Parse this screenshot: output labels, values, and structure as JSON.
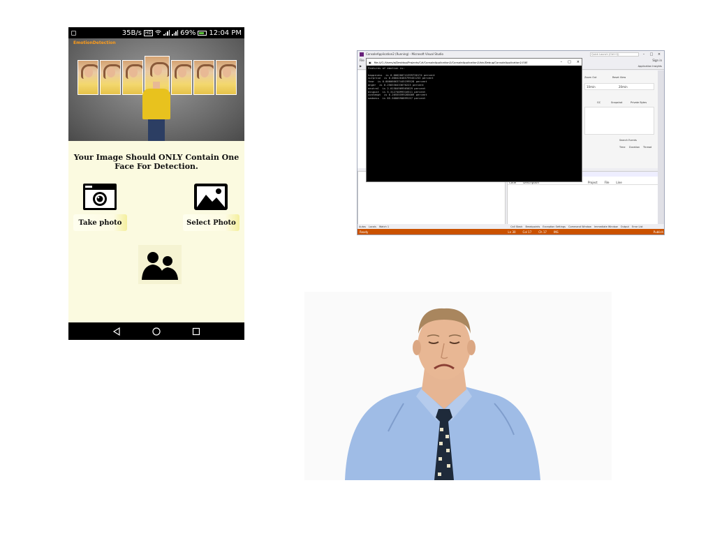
{
  "phone": {
    "status": {
      "speed": "35B/s",
      "battery": "69%",
      "time": "12:04 PM",
      "network": "4G"
    },
    "brand": "EmotionDetection",
    "instruction": "Your Image Should ONLY Contain One Face For Detection.",
    "take_photo_label": "Take photo",
    "select_photo_label": "Select Photo",
    "icons": {
      "camera": "camera-icon",
      "gallery": "image-icon",
      "multiple_faces": "people-icon"
    }
  },
  "vs": {
    "title": "ConsoleApplication2 (Running) - Microsoft Visual Studio",
    "quick_launch": "Quick Launch (Ctrl+Q)",
    "sign_in": "Sign in",
    "app_insights": "Application Insights",
    "bottom_tabs": [
      "Autos",
      "Locals",
      "Watch 1"
    ],
    "bottom_tabs_right": [
      "Call Stack",
      "Breakpoints",
      "Exception Settings",
      "Command Window",
      "Immediate Window",
      "Output",
      "Error List"
    ],
    "status": {
      "ready": "Ready",
      "ln": "Ln 30",
      "col": "Col 17",
      "ch": "Ch 17",
      "ins": "INS",
      "publish": "Publish"
    },
    "diag": {
      "zoom_out": "Zoom Out",
      "reset_view": "Reset View",
      "time1": "10min",
      "time2": "20min",
      "gc": "GC",
      "snapshot": "Snapshot",
      "private_bytes": "Private Bytes",
      "search_events": "Search Events",
      "cols": [
        "Time",
        "Duration",
        "Thread"
      ]
    },
    "errlist": {
      "messages": "0 Messages",
      "build": "Build + IntelliSense",
      "search": "Search Error List",
      "cols": [
        "Code",
        "Description",
        "Project",
        "File",
        "Line"
      ]
    },
    "console": {
      "title": "file:///C:/Users/a/Desktop/Projects/C#/ConsoleApplication2/ConsoleApplication2/bin/Debug/ConsoleApplication2.EXE",
      "text": "Features of emotion is:\n\nhappiness  is 0.000200741399736174 percent\nsurprise  is 0.000426485799451253 percent\nfear  is 0.000066637445199528 percent\nanger  is 0.258330433670223 percent\nneutral  is 2.01584909565029 percent\ndisgust  is 5.31274099316511 percent\ncontempt  is 6.20555599285009 percent\nsadness  is 85.5680590899157 percent"
    }
  }
}
